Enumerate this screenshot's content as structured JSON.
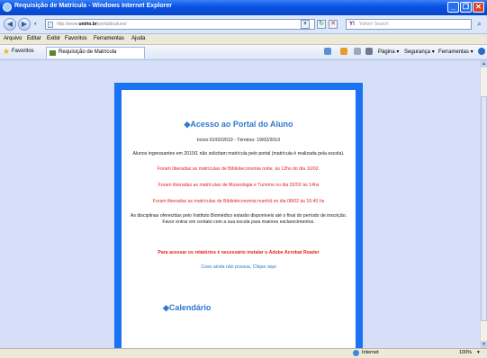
{
  "window": {
    "title": "Requisição de Matrícula - Windows Internet Explorer"
  },
  "titlebar_buttons": [
    "_",
    "❐",
    "✕"
  ],
  "address_bar": {
    "url_prefix": "http://www.",
    "url_bold": "unirio.br",
    "url_suffix": "/portaldoaluno/",
    "search_placeholder": "Yahoo! Search",
    "search_logo": "Y!",
    "back": "◀",
    "forward": "▶",
    "dropdown": "▾",
    "refresh": "↻",
    "stop": "✕",
    "go_dd": "▾",
    "search_go": "⌕"
  },
  "menu": [
    "Arquivo",
    "Editar",
    "Exibir",
    "Favoritos",
    "Ferramentas",
    "Ajuda"
  ],
  "favorites_bar": {
    "favorites_label": "Favoritos",
    "tab_label": "Requisição de Matrícula",
    "commands": [
      "Página ▾",
      "Segurança ▾",
      "Ferramentas ▾"
    ]
  },
  "page": {
    "portal_heading": "◆Acesso ao Portal do Aluno",
    "dates": "Início:01/02/2010 - Término: 19/02/2010",
    "ingressantes": "Alunos ingressantes em 2010/1 não solicitam matrícula pelo portal (matrícula é realizada pela escola).",
    "notice_1": "Foram liberadas as matrículas de Biblioteconomia noite, às 12hs do dia 10/02.",
    "notice_2": "Foram liberadas as matrículas de Museologia e Turismo no dia 02/02 às 14hs",
    "notice_3": "Foram liberadas as matrículas de Biblioteconomia manhã no dia 08/02 às 16:40 hs",
    "disciplinas_1": "As disciplinas oferecidas pelo Instituto Biomédico estarão disponíveis até o final do período de inscrição.",
    "disciplinas_2": "Favor entrar em contato com a sua escola para maiores esclarecimentos.",
    "acrobat": "Para acessar os relatórios é necessário instalar o Adobe Acrobat Reader",
    "acrobat_link": "Caso ainda não possua, Clique aqui",
    "calendar_heading": "◆Calendário"
  },
  "statusbar": {
    "zone": "Internet",
    "zoom": "100%",
    "zoom_dd": "▾"
  }
}
